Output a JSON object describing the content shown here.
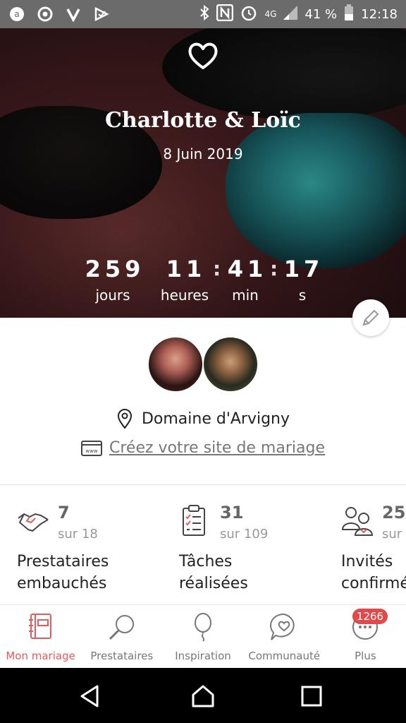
{
  "status_bar": {
    "network": "4G",
    "battery": "41 %",
    "time": "12:18"
  },
  "hero": {
    "names": "Charlotte & Loïc",
    "date": "8 Juin 2019",
    "countdown": {
      "days": "259",
      "days_label": "jours",
      "hours": "11",
      "hours_label": "heures",
      "minutes": "41",
      "minutes_label": "min",
      "seconds": "17",
      "seconds_label": "s",
      "separator": ":"
    }
  },
  "profile": {
    "location": "Domaine d'Arvigny",
    "website_link": "Créez votre site de mariage"
  },
  "stats": [
    {
      "value": "7",
      "of": "sur 18",
      "label_line1": "Prestataires",
      "label_line2": "embauchés",
      "icon": "handshake-icon"
    },
    {
      "value": "31",
      "of": "sur 109",
      "label_line1": "Tâches",
      "label_line2": "réalisées",
      "icon": "checklist-icon"
    },
    {
      "value": "25",
      "of": "sur",
      "label_line1": "Invités",
      "label_line2": "confirmés",
      "icon": "guests-icon"
    }
  ],
  "bottom_nav": {
    "items": [
      {
        "label": "Mon mariage",
        "icon": "notebook-icon"
      },
      {
        "label": "Prestataires",
        "icon": "magnifier-icon"
      },
      {
        "label": "Inspiration",
        "icon": "balloon-icon"
      },
      {
        "label": "Communauté",
        "icon": "chat-heart-icon"
      },
      {
        "label": "Plus",
        "icon": "more-icon"
      }
    ],
    "badge": "1266",
    "active_color": "#e55b5b"
  }
}
